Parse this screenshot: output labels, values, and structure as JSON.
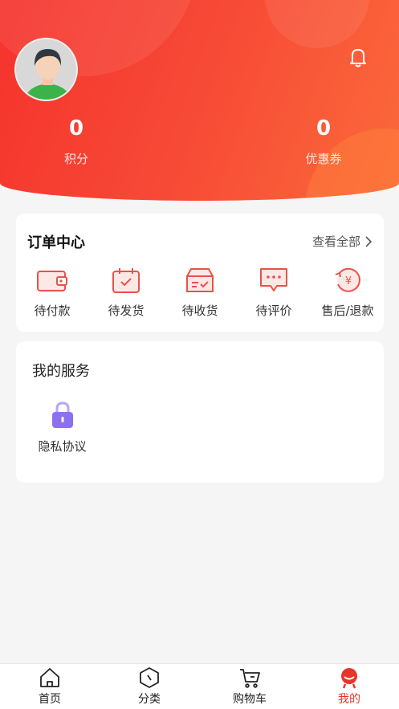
{
  "profile": {
    "points_value": "0",
    "points_label": "积分",
    "coupons_value": "0",
    "coupons_label": "优惠券"
  },
  "orders": {
    "title": "订单中心",
    "view_all": "查看全部",
    "items": [
      {
        "label": "待付款",
        "icon": "wallet-icon"
      },
      {
        "label": "待发货",
        "icon": "calendar-check-icon"
      },
      {
        "label": "待收货",
        "icon": "box-check-icon"
      },
      {
        "label": "待评价",
        "icon": "chat-bubble-icon"
      },
      {
        "label": "售后/退款",
        "icon": "refund-yen-icon"
      }
    ]
  },
  "services": {
    "title": "我的服务",
    "items": [
      {
        "label": "隐私协议",
        "icon": "lock-icon"
      }
    ]
  },
  "tabbar": {
    "items": [
      {
        "label": "首页",
        "icon": "home-icon"
      },
      {
        "label": "分类",
        "icon": "compass-icon"
      },
      {
        "label": "购物车",
        "icon": "cart-icon"
      },
      {
        "label": "我的",
        "icon": "profile-icon"
      }
    ],
    "active_index": 3
  },
  "colors": {
    "brand_red": "#f5332d",
    "brand_orange": "#fb6a3a",
    "active_tab": "#e8352b",
    "lock_purple": "#8e6ff0"
  }
}
